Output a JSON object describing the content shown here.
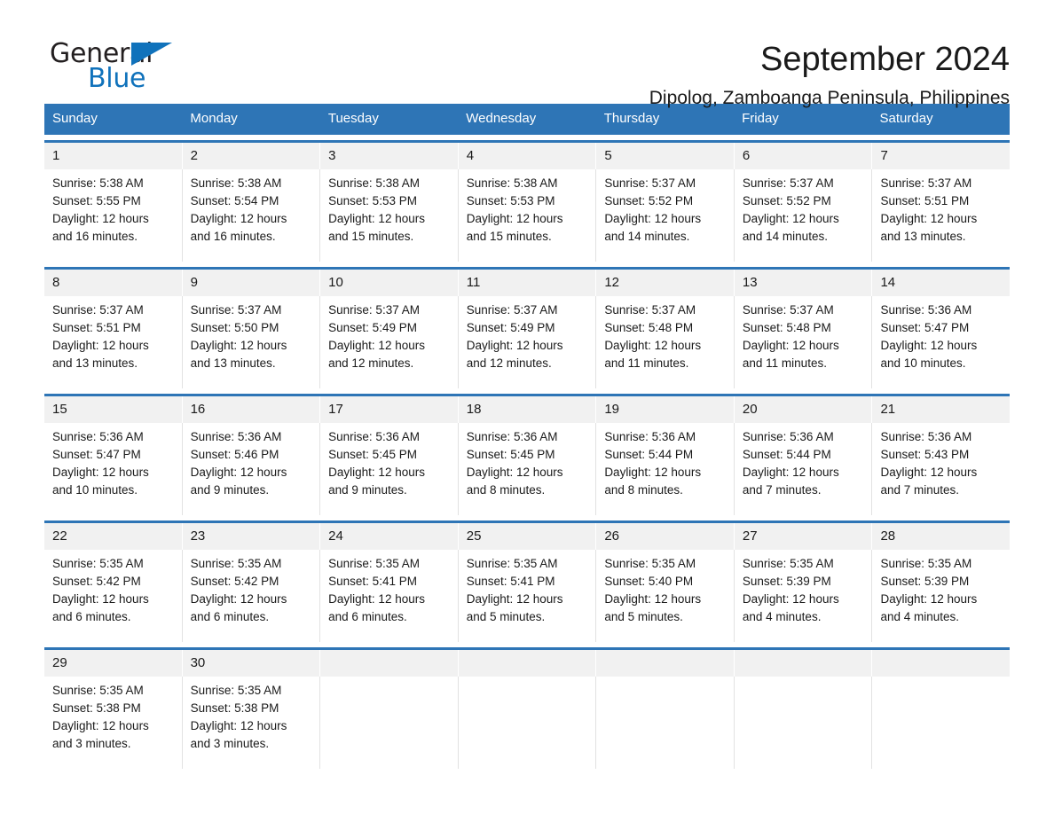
{
  "brand": {
    "name_top": "General",
    "name_bottom": "Blue",
    "accent_color": "#1072bb"
  },
  "header": {
    "title": "September 2024",
    "subtitle": "Dipolog, Zamboanga Peninsula, Philippines",
    "header_bg_color": "#2e75b6"
  },
  "calendar": {
    "weekdays": [
      "Sunday",
      "Monday",
      "Tuesday",
      "Wednesday",
      "Thursday",
      "Friday",
      "Saturday"
    ],
    "labels": {
      "sunrise": "Sunrise:",
      "sunset": "Sunset:",
      "daylight": "Daylight:"
    },
    "weeks": [
      {
        "days": [
          {
            "num": "1",
            "sunrise": "Sunrise: 5:38 AM",
            "sunset": "Sunset: 5:55 PM",
            "daylight_1": "Daylight: 12 hours",
            "daylight_2": "and 16 minutes."
          },
          {
            "num": "2",
            "sunrise": "Sunrise: 5:38 AM",
            "sunset": "Sunset: 5:54 PM",
            "daylight_1": "Daylight: 12 hours",
            "daylight_2": "and 16 minutes."
          },
          {
            "num": "3",
            "sunrise": "Sunrise: 5:38 AM",
            "sunset": "Sunset: 5:53 PM",
            "daylight_1": "Daylight: 12 hours",
            "daylight_2": "and 15 minutes."
          },
          {
            "num": "4",
            "sunrise": "Sunrise: 5:38 AM",
            "sunset": "Sunset: 5:53 PM",
            "daylight_1": "Daylight: 12 hours",
            "daylight_2": "and 15 minutes."
          },
          {
            "num": "5",
            "sunrise": "Sunrise: 5:37 AM",
            "sunset": "Sunset: 5:52 PM",
            "daylight_1": "Daylight: 12 hours",
            "daylight_2": "and 14 minutes."
          },
          {
            "num": "6",
            "sunrise": "Sunrise: 5:37 AM",
            "sunset": "Sunset: 5:52 PM",
            "daylight_1": "Daylight: 12 hours",
            "daylight_2": "and 14 minutes."
          },
          {
            "num": "7",
            "sunrise": "Sunrise: 5:37 AM",
            "sunset": "Sunset: 5:51 PM",
            "daylight_1": "Daylight: 12 hours",
            "daylight_2": "and 13 minutes."
          }
        ]
      },
      {
        "days": [
          {
            "num": "8",
            "sunrise": "Sunrise: 5:37 AM",
            "sunset": "Sunset: 5:51 PM",
            "daylight_1": "Daylight: 12 hours",
            "daylight_2": "and 13 minutes."
          },
          {
            "num": "9",
            "sunrise": "Sunrise: 5:37 AM",
            "sunset": "Sunset: 5:50 PM",
            "daylight_1": "Daylight: 12 hours",
            "daylight_2": "and 13 minutes."
          },
          {
            "num": "10",
            "sunrise": "Sunrise: 5:37 AM",
            "sunset": "Sunset: 5:49 PM",
            "daylight_1": "Daylight: 12 hours",
            "daylight_2": "and 12 minutes."
          },
          {
            "num": "11",
            "sunrise": "Sunrise: 5:37 AM",
            "sunset": "Sunset: 5:49 PM",
            "daylight_1": "Daylight: 12 hours",
            "daylight_2": "and 12 minutes."
          },
          {
            "num": "12",
            "sunrise": "Sunrise: 5:37 AM",
            "sunset": "Sunset: 5:48 PM",
            "daylight_1": "Daylight: 12 hours",
            "daylight_2": "and 11 minutes."
          },
          {
            "num": "13",
            "sunrise": "Sunrise: 5:37 AM",
            "sunset": "Sunset: 5:48 PM",
            "daylight_1": "Daylight: 12 hours",
            "daylight_2": "and 11 minutes."
          },
          {
            "num": "14",
            "sunrise": "Sunrise: 5:36 AM",
            "sunset": "Sunset: 5:47 PM",
            "daylight_1": "Daylight: 12 hours",
            "daylight_2": "and 10 minutes."
          }
        ]
      },
      {
        "days": [
          {
            "num": "15",
            "sunrise": "Sunrise: 5:36 AM",
            "sunset": "Sunset: 5:47 PM",
            "daylight_1": "Daylight: 12 hours",
            "daylight_2": "and 10 minutes."
          },
          {
            "num": "16",
            "sunrise": "Sunrise: 5:36 AM",
            "sunset": "Sunset: 5:46 PM",
            "daylight_1": "Daylight: 12 hours",
            "daylight_2": "and 9 minutes."
          },
          {
            "num": "17",
            "sunrise": "Sunrise: 5:36 AM",
            "sunset": "Sunset: 5:45 PM",
            "daylight_1": "Daylight: 12 hours",
            "daylight_2": "and 9 minutes."
          },
          {
            "num": "18",
            "sunrise": "Sunrise: 5:36 AM",
            "sunset": "Sunset: 5:45 PM",
            "daylight_1": "Daylight: 12 hours",
            "daylight_2": "and 8 minutes."
          },
          {
            "num": "19",
            "sunrise": "Sunrise: 5:36 AM",
            "sunset": "Sunset: 5:44 PM",
            "daylight_1": "Daylight: 12 hours",
            "daylight_2": "and 8 minutes."
          },
          {
            "num": "20",
            "sunrise": "Sunrise: 5:36 AM",
            "sunset": "Sunset: 5:44 PM",
            "daylight_1": "Daylight: 12 hours",
            "daylight_2": "and 7 minutes."
          },
          {
            "num": "21",
            "sunrise": "Sunrise: 5:36 AM",
            "sunset": "Sunset: 5:43 PM",
            "daylight_1": "Daylight: 12 hours",
            "daylight_2": "and 7 minutes."
          }
        ]
      },
      {
        "days": [
          {
            "num": "22",
            "sunrise": "Sunrise: 5:35 AM",
            "sunset": "Sunset: 5:42 PM",
            "daylight_1": "Daylight: 12 hours",
            "daylight_2": "and 6 minutes."
          },
          {
            "num": "23",
            "sunrise": "Sunrise: 5:35 AM",
            "sunset": "Sunset: 5:42 PM",
            "daylight_1": "Daylight: 12 hours",
            "daylight_2": "and 6 minutes."
          },
          {
            "num": "24",
            "sunrise": "Sunrise: 5:35 AM",
            "sunset": "Sunset: 5:41 PM",
            "daylight_1": "Daylight: 12 hours",
            "daylight_2": "and 6 minutes."
          },
          {
            "num": "25",
            "sunrise": "Sunrise: 5:35 AM",
            "sunset": "Sunset: 5:41 PM",
            "daylight_1": "Daylight: 12 hours",
            "daylight_2": "and 5 minutes."
          },
          {
            "num": "26",
            "sunrise": "Sunrise: 5:35 AM",
            "sunset": "Sunset: 5:40 PM",
            "daylight_1": "Daylight: 12 hours",
            "daylight_2": "and 5 minutes."
          },
          {
            "num": "27",
            "sunrise": "Sunrise: 5:35 AM",
            "sunset": "Sunset: 5:39 PM",
            "daylight_1": "Daylight: 12 hours",
            "daylight_2": "and 4 minutes."
          },
          {
            "num": "28",
            "sunrise": "Sunrise: 5:35 AM",
            "sunset": "Sunset: 5:39 PM",
            "daylight_1": "Daylight: 12 hours",
            "daylight_2": "and 4 minutes."
          }
        ]
      },
      {
        "days": [
          {
            "num": "29",
            "sunrise": "Sunrise: 5:35 AM",
            "sunset": "Sunset: 5:38 PM",
            "daylight_1": "Daylight: 12 hours",
            "daylight_2": "and 3 minutes."
          },
          {
            "num": "30",
            "sunrise": "Sunrise: 5:35 AM",
            "sunset": "Sunset: 5:38 PM",
            "daylight_1": "Daylight: 12 hours",
            "daylight_2": "and 3 minutes."
          },
          {
            "num": "",
            "sunrise": "",
            "sunset": "",
            "daylight_1": "",
            "daylight_2": ""
          },
          {
            "num": "",
            "sunrise": "",
            "sunset": "",
            "daylight_1": "",
            "daylight_2": ""
          },
          {
            "num": "",
            "sunrise": "",
            "sunset": "",
            "daylight_1": "",
            "daylight_2": ""
          },
          {
            "num": "",
            "sunrise": "",
            "sunset": "",
            "daylight_1": "",
            "daylight_2": ""
          },
          {
            "num": "",
            "sunrise": "",
            "sunset": "",
            "daylight_1": "",
            "daylight_2": ""
          }
        ]
      }
    ]
  }
}
